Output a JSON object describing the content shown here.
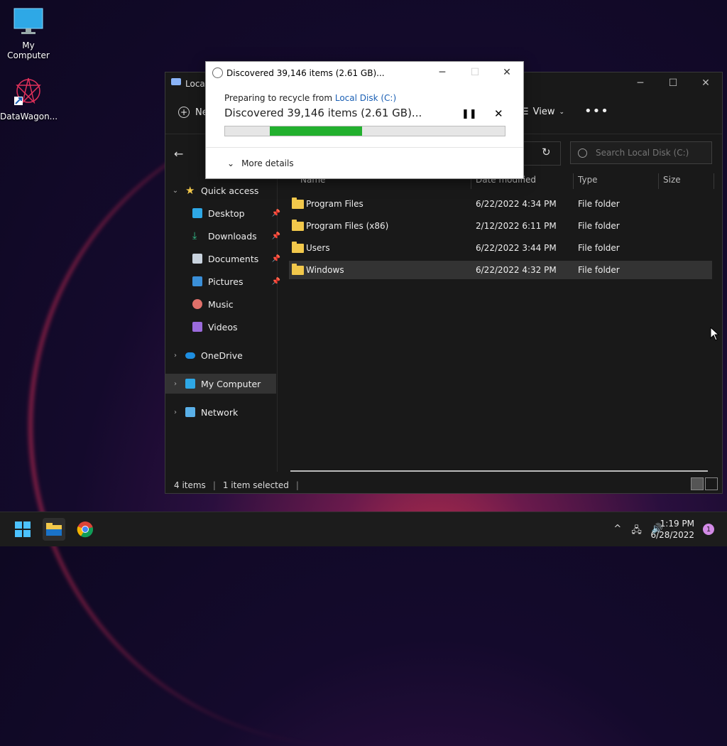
{
  "desktop": {
    "icons": [
      {
        "label": "My Computer"
      },
      {
        "label": "DataWagon..."
      }
    ]
  },
  "explorer": {
    "title": "Local",
    "toolbar": {
      "new_label": "Ne",
      "view_label": "View",
      "more_label": "•••"
    },
    "search_placeholder": "Search Local Disk (C:)",
    "nav": [
      {
        "label": "Quick access"
      },
      {
        "label": "Desktop"
      },
      {
        "label": "Downloads"
      },
      {
        "label": "Documents"
      },
      {
        "label": "Pictures"
      },
      {
        "label": "Music"
      },
      {
        "label": "Videos"
      },
      {
        "label": "OneDrive"
      },
      {
        "label": "My Computer"
      },
      {
        "label": "Network"
      }
    ],
    "columns": {
      "name": "Name",
      "date": "Date modified",
      "type": "Type",
      "size": "Size"
    },
    "rows": [
      {
        "name": "Program Files",
        "date": "6/22/2022 4:34 PM",
        "type": "File folder"
      },
      {
        "name": "Program Files (x86)",
        "date": "2/12/2022 6:11 PM",
        "type": "File folder"
      },
      {
        "name": "Users",
        "date": "6/22/2022 3:44 PM",
        "type": "File folder"
      },
      {
        "name": "Windows",
        "date": "6/22/2022 4:32 PM",
        "type": "File folder"
      }
    ],
    "status": {
      "count": "4 items",
      "selected": "1 item selected"
    }
  },
  "dialog": {
    "title": "Discovered 39,146 items (2.61 GB)...",
    "prep_text": "Preparing to recycle from ",
    "prep_link": "Local Disk (C:)",
    "headline": "Discovered 39,146 items (2.61 GB)...",
    "more_details": "More details",
    "progress_indeterminate_segment": {
      "start": 0.16,
      "end": 0.49
    }
  },
  "taskbar": {
    "time": "1:19 PM",
    "date": "6/28/2022",
    "notifications": "1"
  },
  "colors": {
    "progress": "#22b02e",
    "link": "#1a5fb4",
    "folder": "#f2c84b"
  }
}
